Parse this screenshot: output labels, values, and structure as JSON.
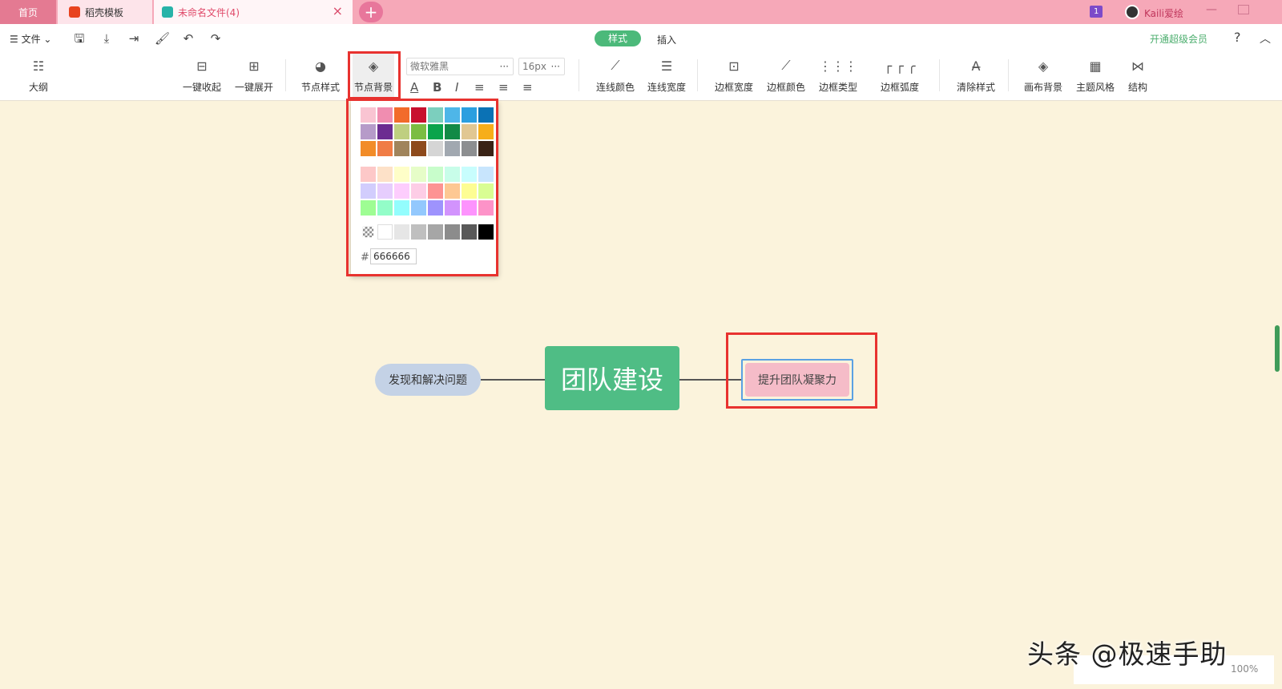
{
  "tabs": [
    {
      "label": "首页"
    },
    {
      "label": "稻壳模板"
    },
    {
      "label": "未命名文件(4)"
    }
  ],
  "titlebar": {
    "add_tab": "+",
    "notif_count": "1",
    "username": "Kaili爱绘",
    "close_tab": "×"
  },
  "menu": {
    "file": "文件",
    "mode_style": "样式",
    "mode_insert": "插入",
    "vip": "开通超级会员",
    "help": "?"
  },
  "toolbar": {
    "outline": "大纲",
    "collapse_all": "一键收起",
    "expand_all": "一键展开",
    "node_style": "节点样式",
    "node_bg": "节点背景",
    "font_family": "微软雅黑",
    "font_size": "16px",
    "more": "···",
    "line_color": "连线颜色",
    "line_width": "连线宽度",
    "border_width": "边框宽度",
    "border_color": "边框颜色",
    "border_type": "边框类型",
    "border_radius": "边框弧度",
    "clear_style": "清除样式",
    "canvas_bg": "画布背景",
    "theme_style": "主题风格",
    "structure": "结构"
  },
  "color_picker": {
    "palette_main": [
      "#f9c4d2",
      "#f08db0",
      "#f26b2b",
      "#c8102e",
      "#7ccfbe",
      "#4eb6e8",
      "#2b9fe0",
      "#0b72b5",
      "#b69bc9",
      "#6c2c91",
      "#bfcf80",
      "#7bbd43",
      "#0aa44b",
      "#128a46",
      "#e1c792",
      "#f6ae1a",
      "#f28c28",
      "#f07c45",
      "#a0845c",
      "#8e4a1c",
      "#d5d5d5",
      "#a1a8b0",
      "#8c8e90",
      "#3a2316"
    ],
    "palette_light": [
      "#fdc8c8",
      "#fde1c8",
      "#fefec8",
      "#e6fdc8",
      "#c8fdcb",
      "#c8fde9",
      "#c8fdfd",
      "#c8e5fd",
      "#d2cdfd",
      "#e6cdfd",
      "#fdcdfd",
      "#fdcde6",
      "#fd9393",
      "#fdc893",
      "#fdfd93",
      "#d9fd93",
      "#9efd93",
      "#93fdc8",
      "#93fdfd",
      "#93c8fd",
      "#9e93fd",
      "#d293fd",
      "#fd93fd",
      "#fd93c8"
    ],
    "palette_gray": [
      "#ffffff",
      "#e6e6e6",
      "#bfbfbf",
      "#a6a6a6",
      "#8c8c8c",
      "#595959",
      "#000000"
    ],
    "hex_prefix": "#",
    "hex_value": "666666"
  },
  "mindmap": {
    "center": "团队建设",
    "left": "发现和解决问题",
    "right": "提升团队凝聚力"
  },
  "zoom": "100%",
  "watermark": "头条 @极速手助"
}
